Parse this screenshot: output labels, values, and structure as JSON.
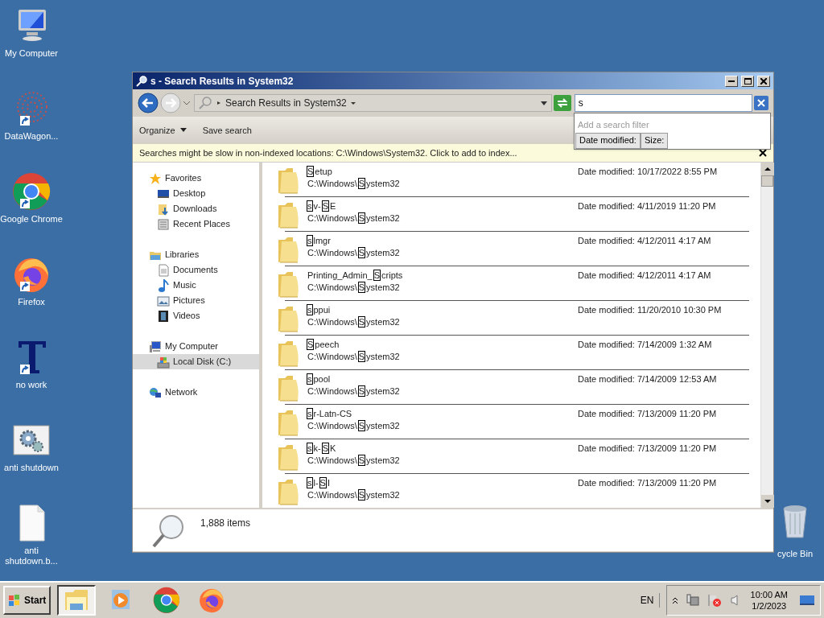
{
  "desktop_icons": [
    {
      "label": "My Computer",
      "kind": "computer",
      "shortcut": false
    },
    {
      "label": "DataWagon...",
      "kind": "dots",
      "shortcut": true
    },
    {
      "label": "Google Chrome",
      "kind": "chrome",
      "shortcut": true
    },
    {
      "label": "Firefox",
      "kind": "firefox",
      "shortcut": true
    },
    {
      "label": "no work",
      "kind": "font",
      "shortcut": true
    },
    {
      "label": "anti shutdown",
      "kind": "gears",
      "shortcut": false
    },
    {
      "label": "anti shutdown.b...",
      "kind": "file",
      "shortcut": false
    }
  ],
  "recycle_bin": {
    "label": "cycle Bin"
  },
  "window": {
    "title": "s - Search Results in System32",
    "address": "Search Results in System32",
    "search": {
      "value": "s",
      "filter_placeholder": "Add a search filter",
      "filters": [
        "Date modified:",
        "Size:"
      ]
    },
    "commands": [
      {
        "label": "Organize",
        "dropdown": true
      },
      {
        "label": "Save search",
        "dropdown": false
      }
    ],
    "info_bar": "Searches might be slow in non-indexed locations: C:\\Windows\\System32. Click to add to index...",
    "nav": [
      {
        "label": "Favorites",
        "kind": "star",
        "selected": false,
        "children": [
          {
            "label": "Desktop",
            "kind": "desktop",
            "selected": false
          },
          {
            "label": "Downloads",
            "kind": "downloads",
            "selected": false
          },
          {
            "label": "Recent Places",
            "kind": "recent",
            "selected": false
          }
        ]
      },
      {
        "label": "Libraries",
        "kind": "library",
        "selected": false,
        "children": [
          {
            "label": "Documents",
            "kind": "document",
            "selected": false
          },
          {
            "label": "Music",
            "kind": "music",
            "selected": false
          },
          {
            "label": "Pictures",
            "kind": "pictures",
            "selected": false
          },
          {
            "label": "Videos",
            "kind": "video",
            "selected": false
          }
        ]
      },
      {
        "label": "My Computer",
        "kind": "computer",
        "selected": false,
        "children": [
          {
            "label": "Local Disk (C:)",
            "kind": "disk",
            "selected": true
          }
        ]
      },
      {
        "label": "Network",
        "kind": "network",
        "selected": false
      }
    ],
    "results": [
      {
        "name": [
          {
            "text": "S",
            "match": true
          },
          {
            "text": "etup",
            "match": false
          }
        ],
        "path": [
          {
            "text": "C:\\Windows\\",
            "match": false
          },
          {
            "text": "S",
            "match": true
          },
          {
            "text": "ystem32",
            "match": false
          }
        ],
        "date": "Date modified: 10/17/2022 8:55 PM"
      },
      {
        "name": [
          {
            "text": "s",
            "match": true
          },
          {
            "text": "v-",
            "match": false
          },
          {
            "text": "S",
            "match": true
          },
          {
            "text": "E",
            "match": false
          }
        ],
        "path": [
          {
            "text": "C:\\Windows\\",
            "match": false
          },
          {
            "text": "S",
            "match": true
          },
          {
            "text": "ystem32",
            "match": false
          }
        ],
        "date": "Date modified: 4/11/2019 11:20 PM"
      },
      {
        "name": [
          {
            "text": "s",
            "match": true
          },
          {
            "text": "lmgr",
            "match": false
          }
        ],
        "path": [
          {
            "text": "C:\\Windows\\",
            "match": false
          },
          {
            "text": "S",
            "match": true
          },
          {
            "text": "ystem32",
            "match": false
          }
        ],
        "date": "Date modified: 4/12/2011 4:17 AM"
      },
      {
        "name": [
          {
            "text": "Printing_Admin_",
            "match": false
          },
          {
            "text": "S",
            "match": true
          },
          {
            "text": "cripts",
            "match": false
          }
        ],
        "path": [
          {
            "text": "C:\\Windows\\",
            "match": false
          },
          {
            "text": "S",
            "match": true
          },
          {
            "text": "ystem32",
            "match": false
          }
        ],
        "date": "Date modified: 4/12/2011 4:17 AM"
      },
      {
        "name": [
          {
            "text": "s",
            "match": true
          },
          {
            "text": "ppui",
            "match": false
          }
        ],
        "path": [
          {
            "text": "C:\\Windows\\",
            "match": false
          },
          {
            "text": "S",
            "match": true
          },
          {
            "text": "ystem32",
            "match": false
          }
        ],
        "date": "Date modified: 11/20/2010 10:30 PM"
      },
      {
        "name": [
          {
            "text": "S",
            "match": true
          },
          {
            "text": "peech",
            "match": false
          }
        ],
        "path": [
          {
            "text": "C:\\Windows\\",
            "match": false
          },
          {
            "text": "S",
            "match": true
          },
          {
            "text": "ystem32",
            "match": false
          }
        ],
        "date": "Date modified: 7/14/2009 1:32 AM"
      },
      {
        "name": [
          {
            "text": "s",
            "match": true
          },
          {
            "text": "pool",
            "match": false
          }
        ],
        "path": [
          {
            "text": "C:\\Windows\\",
            "match": false
          },
          {
            "text": "S",
            "match": true
          },
          {
            "text": "ystem32",
            "match": false
          }
        ],
        "date": "Date modified: 7/14/2009 12:53 AM"
      },
      {
        "name": [
          {
            "text": "s",
            "match": true
          },
          {
            "text": "r-Latn-CS",
            "match": false
          }
        ],
        "path": [
          {
            "text": "C:\\Windows\\",
            "match": false
          },
          {
            "text": "S",
            "match": true
          },
          {
            "text": "ystem32",
            "match": false
          }
        ],
        "date": "Date modified: 7/13/2009 11:20 PM"
      },
      {
        "name": [
          {
            "text": "s",
            "match": true
          },
          {
            "text": "k-",
            "match": false
          },
          {
            "text": "S",
            "match": true
          },
          {
            "text": "K",
            "match": false
          }
        ],
        "path": [
          {
            "text": "C:\\Windows\\",
            "match": false
          },
          {
            "text": "S",
            "match": true
          },
          {
            "text": "ystem32",
            "match": false
          }
        ],
        "date": "Date modified: 7/13/2009 11:20 PM"
      },
      {
        "name": [
          {
            "text": "s",
            "match": true
          },
          {
            "text": "l-",
            "match": false
          },
          {
            "text": "S",
            "match": true
          },
          {
            "text": "I",
            "match": false
          }
        ],
        "path": [
          {
            "text": "C:\\Windows\\",
            "match": false
          },
          {
            "text": "S",
            "match": true
          },
          {
            "text": "ystem32",
            "match": false
          }
        ],
        "date": "Date modified: 7/13/2009 11:20 PM"
      }
    ],
    "status": "1,888 items"
  },
  "taskbar": {
    "start": "Start",
    "apps": [
      {
        "kind": "explorer",
        "selected": true
      },
      {
        "kind": "media",
        "selected": false
      },
      {
        "kind": "chrome",
        "selected": false
      },
      {
        "kind": "firefox",
        "selected": false
      }
    ],
    "language": "EN",
    "time": "10:00 AM",
    "date": "1/2/2023"
  }
}
